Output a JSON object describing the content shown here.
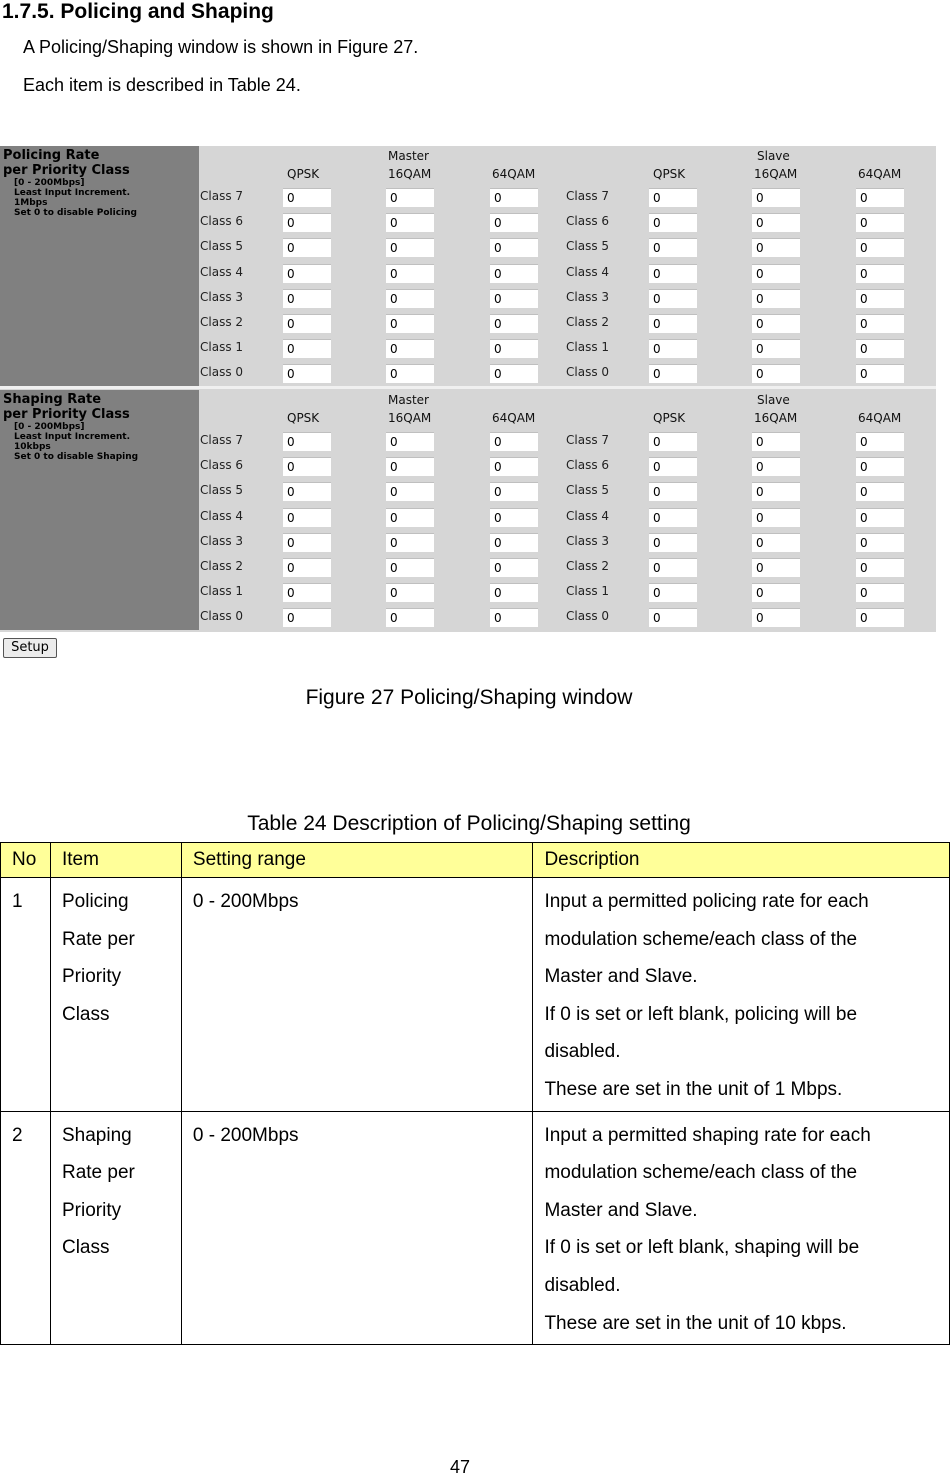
{
  "heading": "1.7.5. Policing and Shaping",
  "intro_lines": [
    "A Policing/Shaping window is shown in Figure 27.",
    "Each item is described in Table 24."
  ],
  "figure": {
    "sections": [
      {
        "title_lines": [
          "Policing Rate",
          "per Priority Class"
        ],
        "notes": [
          "[0 - 200Mbps]",
          "Least Input Increment.",
          "1Mbps",
          "Set 0 to disable Policing"
        ]
      },
      {
        "title_lines": [
          "Shaping Rate",
          "per Priority Class"
        ],
        "notes": [
          "[0 - 200Mbps]",
          "Least Input Increment.",
          "10kbps",
          "Set 0 to disable Shaping"
        ]
      }
    ],
    "groups": [
      "Master",
      "Slave"
    ],
    "columns": [
      "QPSK",
      "16QAM",
      "64QAM"
    ],
    "classes": [
      "Class 7",
      "Class 6",
      "Class 5",
      "Class 4",
      "Class 3",
      "Class 2",
      "Class 1",
      "Class 0"
    ],
    "default_value": "0",
    "setup_button": "Setup"
  },
  "figure_caption": "Figure 27 Policing/Shaping window",
  "table": {
    "caption": "Table 24 Description of Policing/Shaping setting",
    "headers": [
      "No",
      "Item",
      "Setting range",
      "Description"
    ],
    "rows": [
      {
        "no": "1",
        "item_lines": [
          "Policing",
          "Rate per",
          "Priority",
          "Class"
        ],
        "range": "0 - 200Mbps",
        "description_lines": [
          "Input a permitted policing rate for each",
          "modulation scheme/each class of the",
          "Master and Slave.",
          "If 0 is set or left blank, policing will be",
          "disabled.",
          "These are set in the unit of 1 Mbps."
        ]
      },
      {
        "no": "2",
        "item_lines": [
          "Shaping",
          "Rate per",
          "Priority",
          "Class"
        ],
        "range": "0 - 200Mbps",
        "description_lines": [
          "Input a permitted shaping rate for each",
          "modulation scheme/each class of the",
          "Master and Slave.",
          "If 0 is set or left blank, shaping will be",
          "disabled.",
          "These are set in the unit of 10 kbps."
        ]
      }
    ]
  },
  "page_number": "47"
}
